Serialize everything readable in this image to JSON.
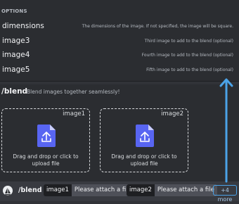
{
  "options": {
    "header": "OPTIONS",
    "items": [
      {
        "name": "dimensions",
        "desc": "The dimensions of the image. If not specified, the image will be square."
      },
      {
        "name": "image3",
        "desc": "Third image to add to the blend (optional)"
      },
      {
        "name": "image4",
        "desc": "Fourth image to add to the blend (optional)"
      },
      {
        "name": "image5",
        "desc": "Fifth image to add to the blend (optional)"
      }
    ]
  },
  "command": {
    "name": "/blend",
    "description": "Blend images together seamlessly!"
  },
  "uploads": [
    {
      "label": "image1",
      "line1": "Drag and drop or click to",
      "line2": "upload file"
    },
    {
      "label": "image2",
      "line1": "Drag and drop or click to",
      "line2": "upload file"
    }
  ],
  "input": {
    "command": "/blend",
    "params": [
      {
        "name": "image1",
        "value": "Please attach a file"
      },
      {
        "name": "image2",
        "value": "Please attach a file"
      }
    ],
    "more": "+4 more"
  },
  "colors": {
    "accent": "#5865f2",
    "arrow": "#4ba3e8"
  }
}
